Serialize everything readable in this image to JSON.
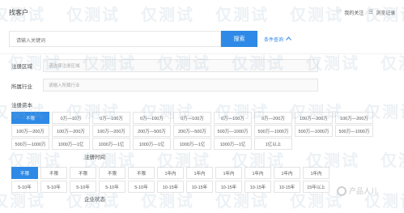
{
  "header": {
    "title": "找客户",
    "my_follow": "我的关注",
    "browse_history": "浏览记录"
  },
  "search": {
    "placeholder": "请输入关键词",
    "button": "搜索",
    "conditions_toggle": "条件查询"
  },
  "filters": {
    "region_label": "注册区域",
    "region_placeholder": "请选择注册区域",
    "industry_label": "所属行业",
    "industry_placeholder": "请输入所属行业",
    "capital_label": "注册资本",
    "capital_options": [
      [
        "不限",
        "0万—10万",
        "0万—100万",
        "0万—100万",
        "0万—100万",
        "0万—100万",
        "0万—200万",
        "100万—200万",
        "100万—200万"
      ],
      [
        "100万—200万",
        "100万—200万",
        "100万—200万",
        "200万—500万",
        "200万—500万",
        "500万—1000万",
        "500万—1000万",
        "500万—1000万",
        "500万—1000万"
      ],
      [
        "500万—1000万",
        "1000万—1亿",
        "1000万—1亿",
        "1000万—1亿",
        "1000万—1亿",
        "1000万—1亿",
        "1亿以上"
      ]
    ],
    "date_label": "注册时间",
    "date_options": [
      [
        "不限",
        "不限",
        "不限",
        "不限",
        "不限",
        "1年内",
        "1年内",
        "1年内",
        "1年内",
        "1年内",
        "1年内"
      ],
      [
        "5-10年",
        "5-10年",
        "5-10年",
        "5-10年",
        "5-10年",
        "10-15年",
        "10-15年",
        "10-15年",
        "10-15年",
        "10-15年",
        "15年以上"
      ]
    ],
    "status_label": "企业状态"
  },
  "watermark": {
    "text": "仅测试"
  },
  "logo": {
    "text": "产品人儿"
  },
  "colors": {
    "accent": "#2e8ae6"
  }
}
